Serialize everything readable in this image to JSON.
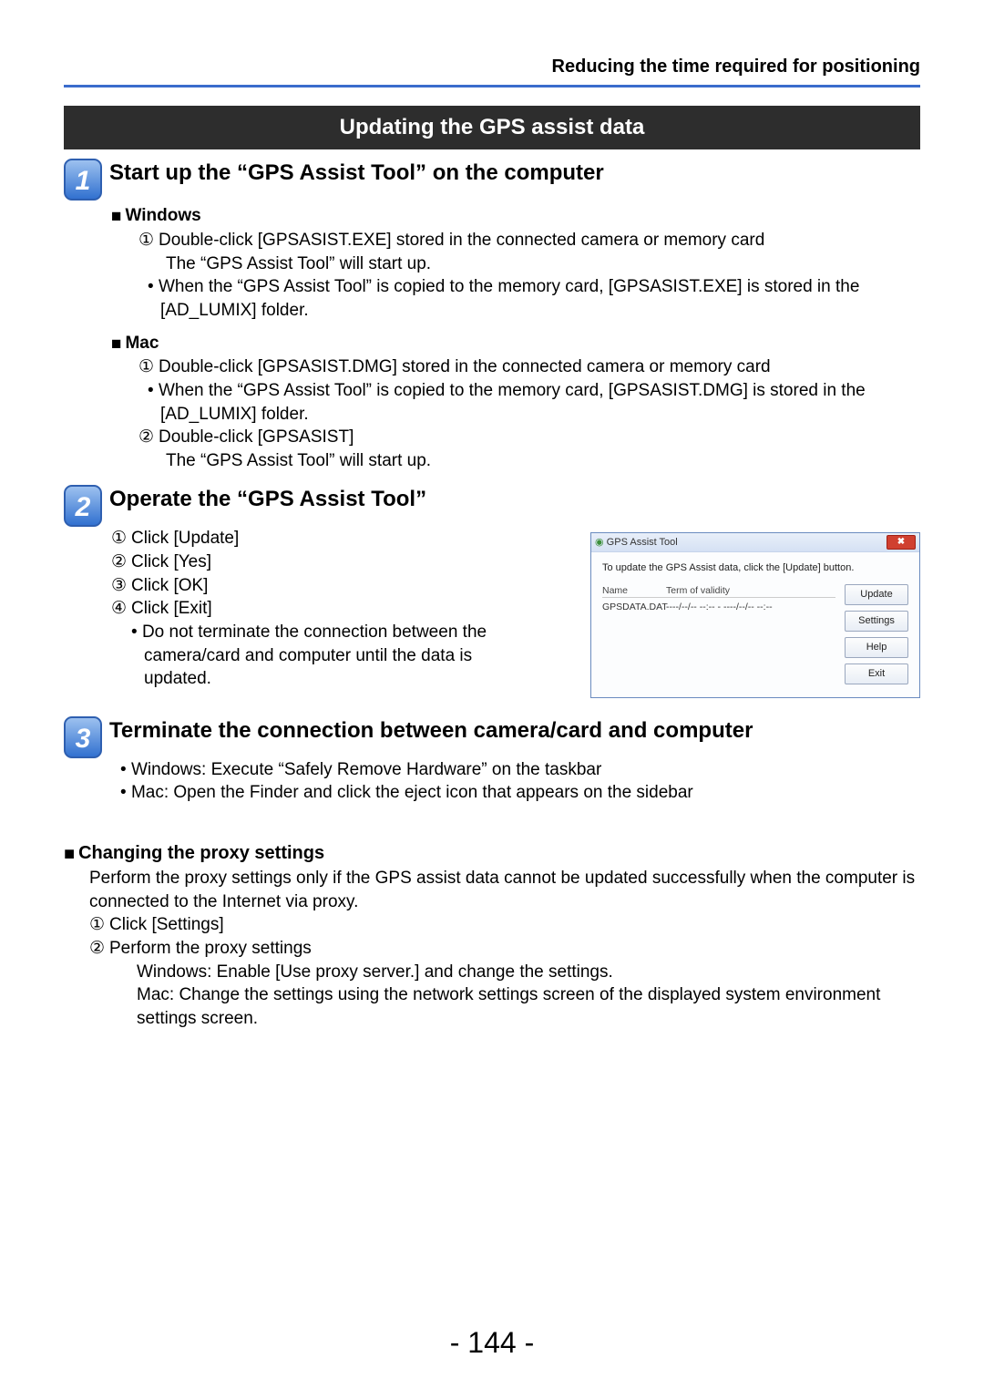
{
  "header_right": "Reducing the time required for positioning",
  "banner": "Updating the GPS assist data",
  "step1": {
    "title": "Start up the “GPS Assist Tool” on the computer",
    "windows_label": "Windows",
    "win_line1": "Double-click [GPSASIST.EXE] stored in the connected camera or memory card",
    "win_line2": "The “GPS Assist Tool” will start up.",
    "win_bullet1": "When the “GPS Assist Tool” is copied to the memory card, [GPSASIST.EXE] is stored in the [AD_LUMIX] folder.",
    "mac_label": "Mac",
    "mac_line1": "Double-click [GPSASIST.DMG] stored in the connected camera or memory card",
    "mac_bullet1": "When the “GPS Assist Tool” is copied to the memory card, [GPSASIST.DMG] is stored in the [AD_LUMIX] folder.",
    "mac_line2": "Double-click [GPSASIST]",
    "mac_line3": "The “GPS Assist Tool” will start up."
  },
  "step2": {
    "title": "Operate the “GPS Assist Tool”",
    "i1": "Click [Update]",
    "i2": "Click [Yes]",
    "i3": "Click [OK]",
    "i4": "Click [Exit]",
    "bullet": "Do not terminate the connection between the camera/card and computer until the data is updated."
  },
  "screenshot": {
    "title": "GPS Assist Tool",
    "message": "To update the GPS Assist data, click the [Update] button.",
    "col1": "Name",
    "col2": "Term of validity",
    "row_name": "GPSDATA.DAT",
    "row_val": "----/--/-- --:-- - ----/--/-- --:--",
    "btn_update": "Update",
    "btn_settings": "Settings",
    "btn_help": "Help",
    "btn_exit": "Exit"
  },
  "step3": {
    "title": "Terminate the connection between camera/card and computer",
    "b1": "Windows: Execute “Safely Remove Hardware” on the taskbar",
    "b2": "Mac: Open the Finder and click the eject icon that appears on the sidebar"
  },
  "proxy": {
    "head": "Changing the proxy settings",
    "intro": "Perform the proxy settings only if the GPS assist data cannot be updated successfully when the computer is connected to the Internet via proxy.",
    "s1": "Click [Settings]",
    "s2": "Perform the proxy settings",
    "win": "Windows: Enable [Use proxy server.] and change the settings.",
    "mac": "Mac: Change the settings using the network settings screen of the displayed system environment settings screen."
  },
  "page_number": "- 144 -"
}
